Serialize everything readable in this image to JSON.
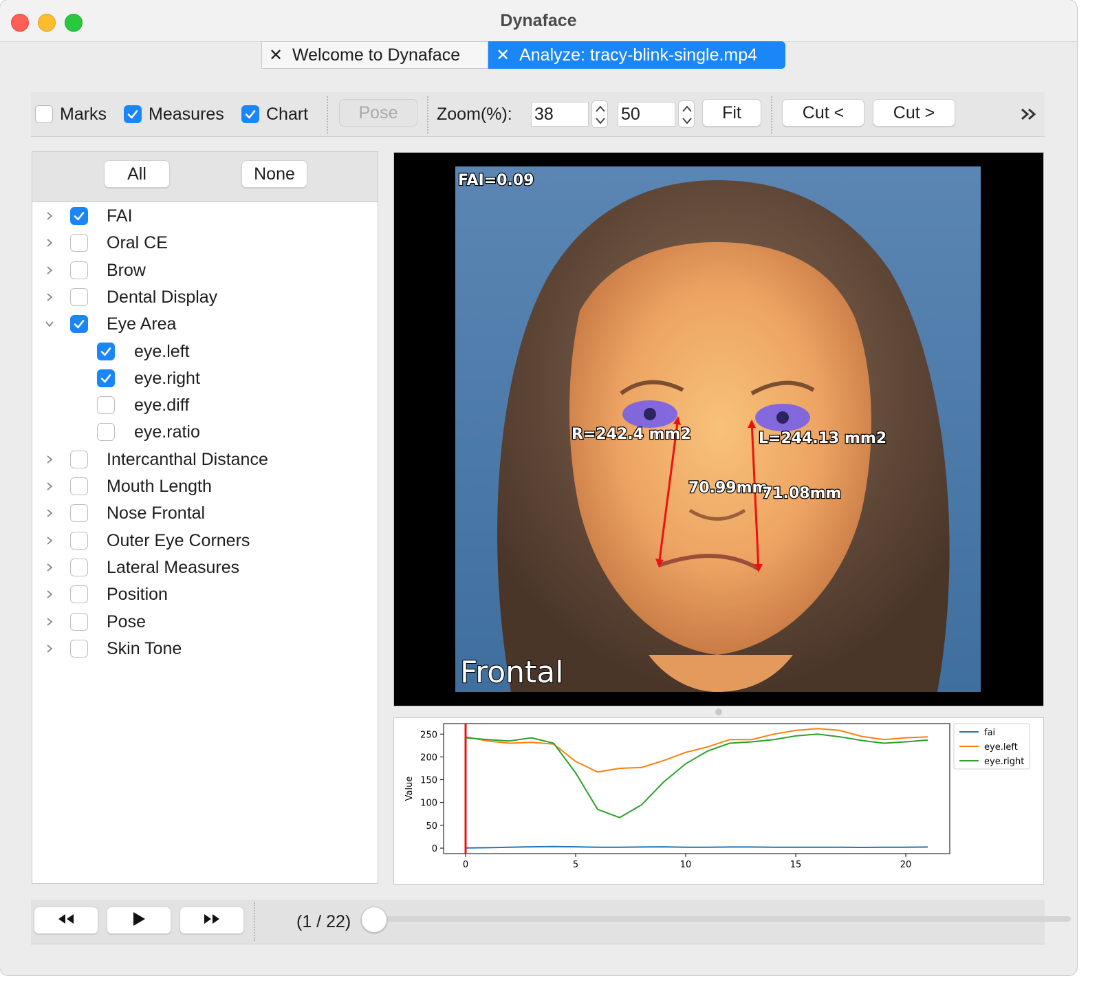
{
  "window": {
    "title": "Dynaface"
  },
  "tabs": [
    {
      "label": "Welcome to Dynaface",
      "active": false,
      "icon": "close-icon"
    },
    {
      "label": "Analyze: tracy-blink-single.mp4",
      "active": true,
      "icon": "close-icon"
    }
  ],
  "toolbar": {
    "marks_label": "Marks",
    "marks_checked": false,
    "measures_label": "Measures",
    "measures_checked": true,
    "chart_label": "Chart",
    "chart_checked": true,
    "pose_label": "Pose",
    "zoom_label": "Zoom(%):",
    "zoom_value_1": "38",
    "zoom_value_2": "50",
    "fit_label": "Fit",
    "cut_left_label": "Cut <",
    "cut_right_label": "Cut >",
    "overflow_icon": "double-chevron-right-icon"
  },
  "measures_panel": {
    "all_label": "All",
    "none_label": "None",
    "items": [
      {
        "label": "FAI",
        "checked": true,
        "expanded": false,
        "level": 0
      },
      {
        "label": "Oral CE",
        "checked": false,
        "expanded": false,
        "level": 0
      },
      {
        "label": "Brow",
        "checked": false,
        "expanded": false,
        "level": 0
      },
      {
        "label": "Dental Display",
        "checked": false,
        "expanded": false,
        "level": 0
      },
      {
        "label": "Eye Area",
        "checked": true,
        "expanded": true,
        "level": 0
      },
      {
        "label": "eye.left",
        "checked": true,
        "level": 1
      },
      {
        "label": "eye.right",
        "checked": true,
        "level": 1
      },
      {
        "label": "eye.diff",
        "checked": false,
        "level": 1
      },
      {
        "label": "eye.ratio",
        "checked": false,
        "level": 1
      },
      {
        "label": "Intercanthal Distance",
        "checked": false,
        "expanded": false,
        "level": 0
      },
      {
        "label": "Mouth Length",
        "checked": false,
        "expanded": false,
        "level": 0
      },
      {
        "label": "Nose Frontal",
        "checked": false,
        "expanded": false,
        "level": 0
      },
      {
        "label": "Outer Eye Corners",
        "checked": false,
        "expanded": false,
        "level": 0
      },
      {
        "label": "Lateral Measures",
        "checked": false,
        "expanded": false,
        "level": 0
      },
      {
        "label": "Position",
        "checked": false,
        "expanded": false,
        "level": 0
      },
      {
        "label": "Pose",
        "checked": false,
        "expanded": false,
        "level": 0
      },
      {
        "label": "Skin Tone",
        "checked": false,
        "expanded": false,
        "level": 0
      }
    ]
  },
  "video": {
    "fai_overlay": "FAI=0.09",
    "right_eye_label": "R=242.4 mm2",
    "left_eye_label": "L=244.13 mm2",
    "right_distance": "70.99mm",
    "left_distance": "71.08mm",
    "view_label": "Frontal"
  },
  "chart_data": {
    "type": "line",
    "ylabel": "Value",
    "xlabel": "",
    "xlim": [
      -1,
      22
    ],
    "ylim": [
      -12,
      273
    ],
    "x_ticks": [
      0,
      5,
      10,
      15,
      20
    ],
    "y_ticks": [
      0,
      50,
      100,
      150,
      200,
      250
    ],
    "current_frame": 0,
    "legend_position": "right",
    "x": [
      0,
      1,
      2,
      3,
      4,
      5,
      6,
      7,
      8,
      9,
      10,
      11,
      12,
      13,
      14,
      15,
      16,
      17,
      18,
      19,
      20,
      21
    ],
    "series": [
      {
        "name": "fai",
        "color": "#1f77b4",
        "values": [
          0.5,
          1,
          2,
          3,
          3.5,
          3,
          2,
          2,
          2.5,
          3,
          2,
          2,
          2.5,
          2.5,
          2,
          2,
          2,
          2,
          1.5,
          2,
          2,
          2.5
        ]
      },
      {
        "name": "eye.left",
        "color": "#ff7f0e",
        "values": [
          244,
          235,
          230,
          232,
          228,
          190,
          167,
          175,
          177,
          192,
          210,
          222,
          238,
          238,
          250,
          258,
          262,
          258,
          245,
          238,
          242,
          244
        ]
      },
      {
        "name": "eye.right",
        "color": "#2ca02c",
        "values": [
          242,
          238,
          235,
          242,
          230,
          165,
          85,
          67,
          95,
          145,
          185,
          213,
          230,
          233,
          238,
          246,
          250,
          244,
          236,
          230,
          233,
          237
        ]
      }
    ]
  },
  "playback": {
    "rewind_icon": "rewind-icon",
    "play_icon": "play-icon",
    "forward_icon": "fast-forward-icon",
    "frame_label": "(1 / 22)",
    "progress": 0
  }
}
